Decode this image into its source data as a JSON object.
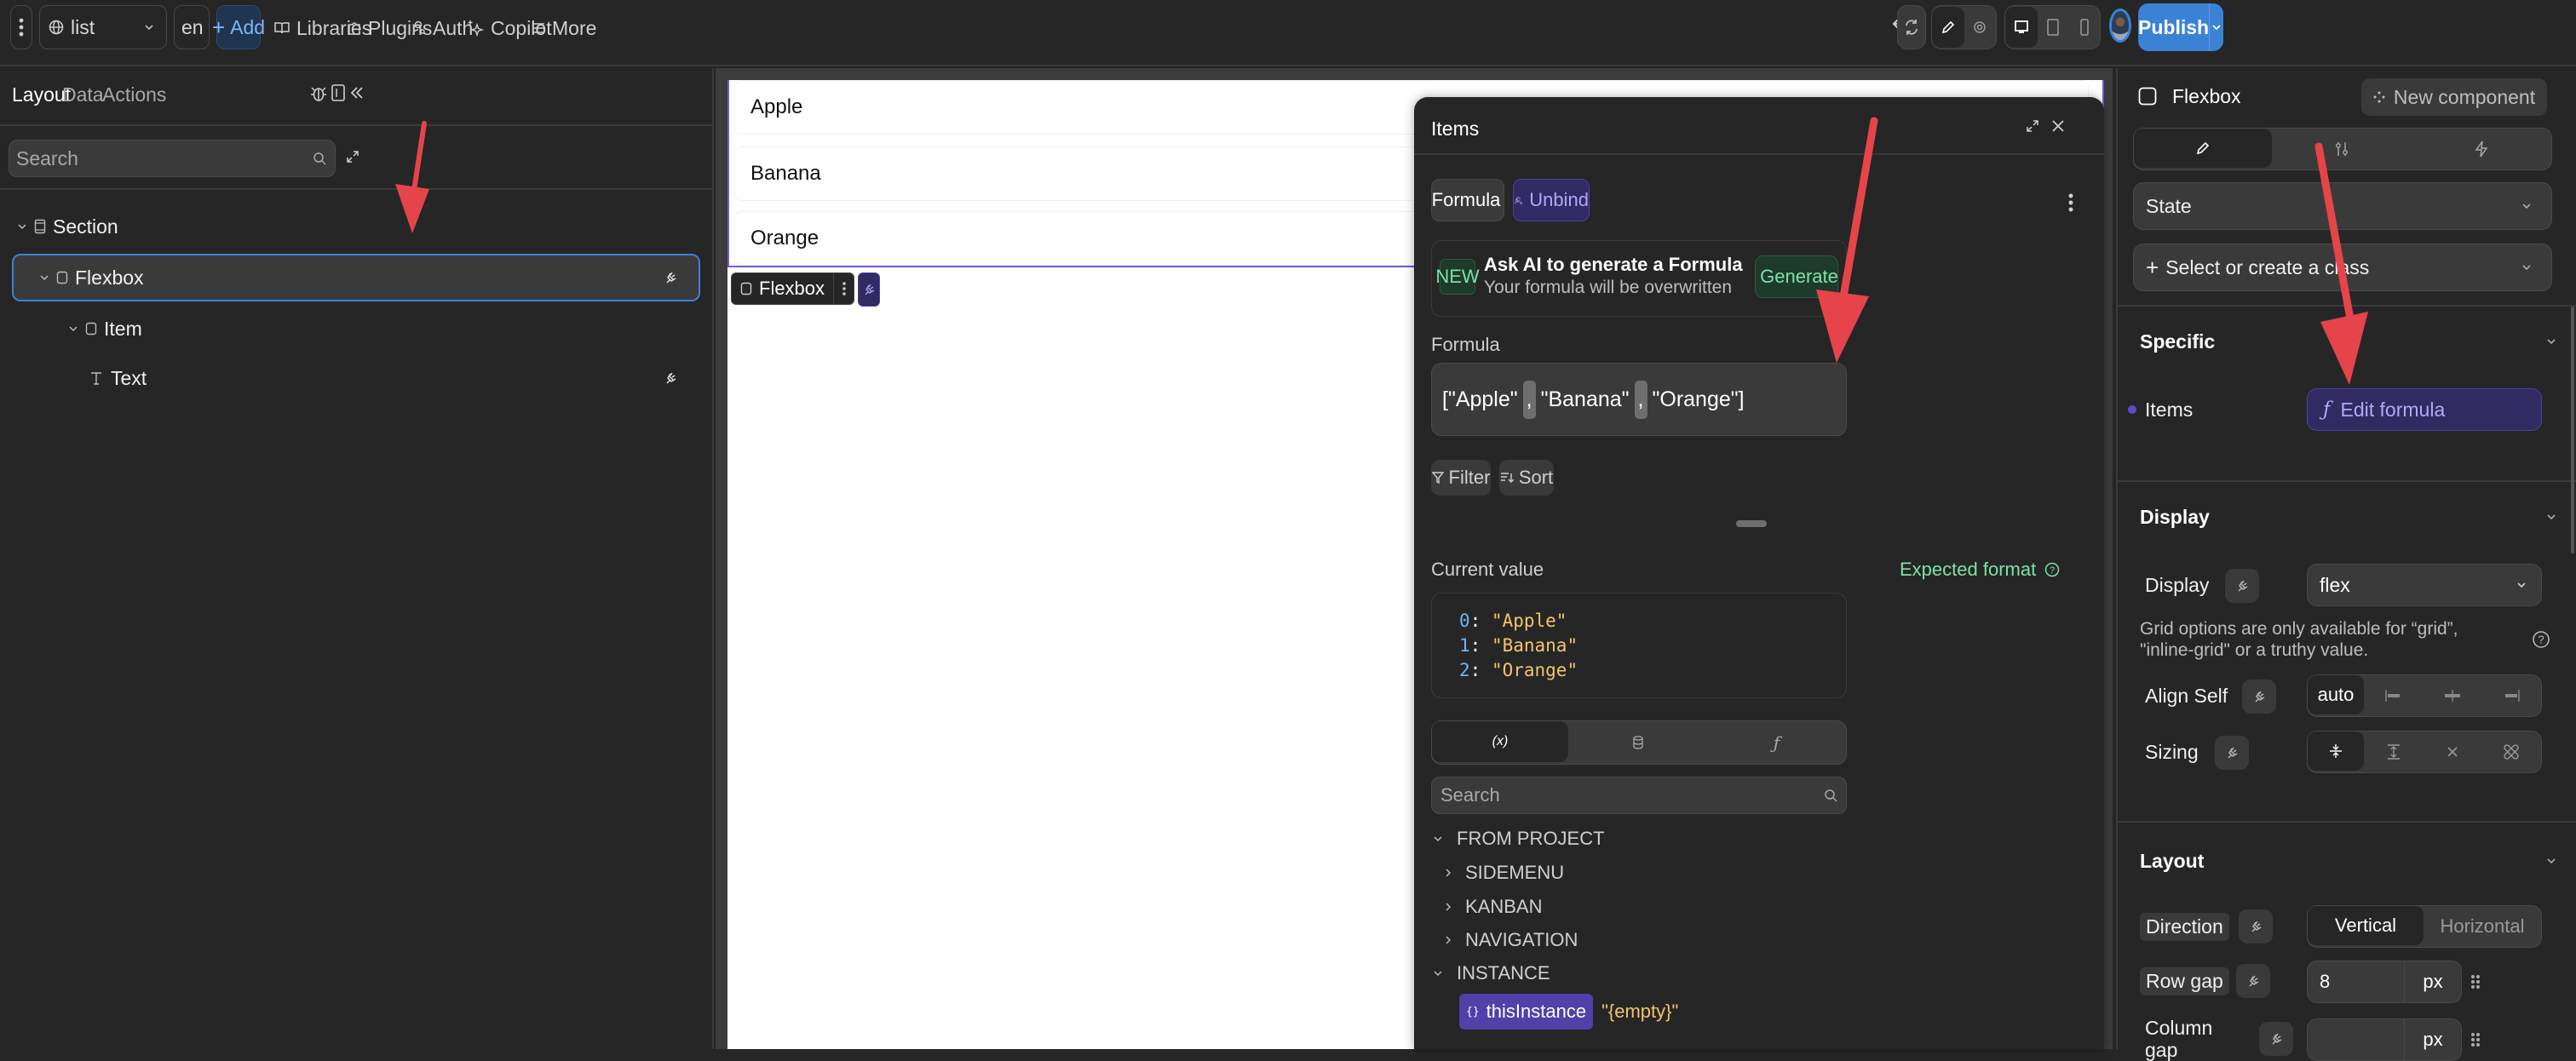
{
  "topbar": {
    "page_select": "list",
    "lang_select": "en",
    "add_label": "Add",
    "links": [
      {
        "label": "Libraries",
        "icon": "book-icon"
      },
      {
        "label": "Plugins",
        "icon": "plugin-icon"
      },
      {
        "label": "Auth",
        "icon": "user-key-icon"
      },
      {
        "label": "Copilot",
        "icon": "sparkle-icon"
      },
      {
        "label": "More",
        "icon": "menu-icon"
      }
    ],
    "publish_label": "Publish"
  },
  "left_panel": {
    "tabs": [
      "Layout",
      "Data",
      "Actions"
    ],
    "active_tab": "Layout",
    "search_placeholder": "Search",
    "tree": [
      {
        "label": "Section",
        "icon": "section-icon",
        "depth": 0,
        "bound": false
      },
      {
        "label": "Flexbox",
        "icon": "box-icon",
        "depth": 1,
        "bound": true,
        "selected": true
      },
      {
        "label": "Item",
        "icon": "box-icon",
        "depth": 2,
        "bound": false
      },
      {
        "label": "Text",
        "icon": "text-icon",
        "depth": 3,
        "bound": true
      }
    ]
  },
  "canvas": {
    "items": [
      "Apple",
      "Banana",
      "Orange"
    ],
    "selection_label": "Flexbox"
  },
  "items_panel": {
    "title": "Items",
    "mode_select": "Formula",
    "unbind_label": "Unbind",
    "ai_badge": "NEW",
    "ai_title": "Ask AI to generate a Formula",
    "ai_subtitle": "Your formula will be overwritten",
    "generate_label": "Generate",
    "formula_label": "Formula",
    "formula_tokens": [
      "[\"Apple\"",
      ",",
      "\"Banana\"",
      ",",
      "\"Orange\"]"
    ],
    "filter_label": "Filter",
    "sort_label": "Sort",
    "current_value_label": "Current value",
    "expected_format_label": "Expected format",
    "current_values": [
      {
        "index": "0",
        "value": "\"Apple\""
      },
      {
        "index": "1",
        "value": "\"Banana\""
      },
      {
        "index": "2",
        "value": "\"Orange\""
      }
    ],
    "source_tabs": [
      "variables-icon",
      "database-icon",
      "function-icon"
    ],
    "search_placeholder": "Search",
    "sources": {
      "from_project": "FROM PROJECT",
      "project_children": [
        "SIDEMENU",
        "KANBAN",
        "NAVIGATION"
      ],
      "instance": "INSTANCE",
      "instance_var": "thisInstance",
      "instance_value": "\"{empty}\""
    }
  },
  "right_panel": {
    "element_name": "Flexbox",
    "new_component_label": "New component",
    "state_label": "State",
    "class_label": "Select or create a class",
    "specific": {
      "title": "Specific",
      "items_label": "Items",
      "edit_formula_label": "Edit formula"
    },
    "display": {
      "title": "Display",
      "display_label": "Display",
      "display_value": "flex",
      "grid_note": "Grid options are only available for “grid”, \"inline-grid\" or a truthy value.",
      "align_self_label": "Align Self",
      "align_self_value": "auto",
      "sizing_label": "Sizing"
    },
    "layout": {
      "title": "Layout",
      "direction_label": "Direction",
      "direction_options": [
        "Vertical",
        "Horizontal"
      ],
      "direction_value": "Vertical",
      "row_gap_label": "Row gap",
      "row_gap_value": "8",
      "row_gap_unit": "px",
      "column_gap_label": "Column gap",
      "column_gap_value": "",
      "column_gap_unit": "px"
    }
  },
  "colors": {
    "accent_blue": "#3b82d6",
    "bind_purple": "#312a63",
    "bind_purple_text": "#a9a0f0",
    "green": "#7ee0a8",
    "annotation_red": "#e5444a"
  }
}
